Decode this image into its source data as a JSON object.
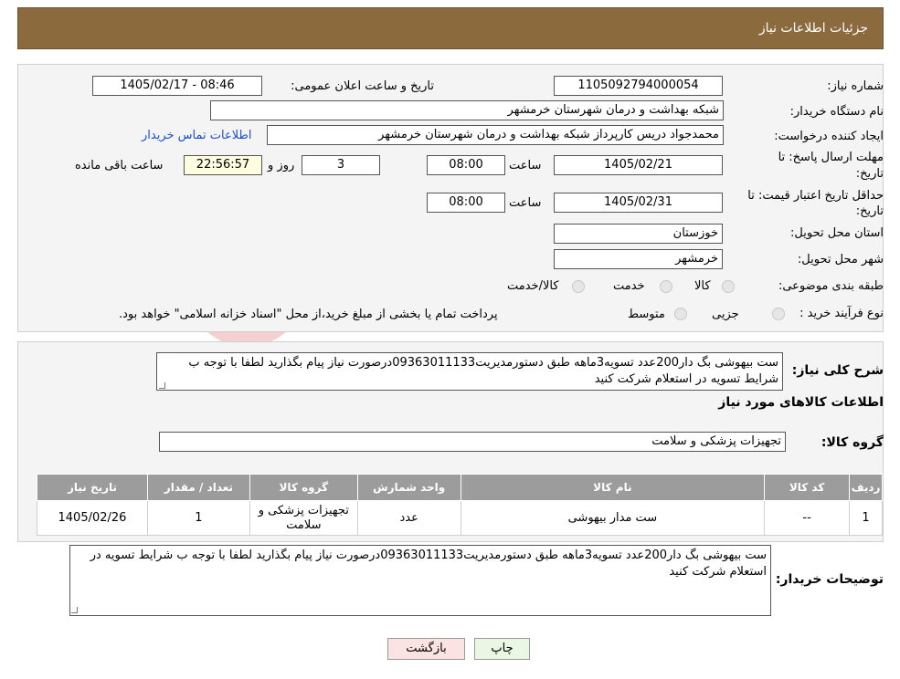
{
  "header": {
    "title": "جزئیات اطلاعات نیاز"
  },
  "fields": {
    "need_number_label": "شماره نیاز:",
    "need_number": "1105092794000054",
    "announce_label": "تاریخ و ساعت اعلان عمومی:",
    "announce_value": "1405/02/17 - 08:46",
    "buyer_org_label": "نام دستگاه خریدار:",
    "buyer_org": "شبکه بهداشت و درمان شهرستان خرمشهر",
    "creator_label": "ایجاد کننده درخواست:",
    "creator": "محمدجواد دریس کارپرداز شبکه بهداشت و درمان شهرستان خرمشهر",
    "contact_link": "اطلاعات تماس خریدار",
    "deadline_label_1": "مهلت ارسال پاسخ: تا",
    "deadline_label_2": "تاریخ:",
    "deadline_date": "1405/02/21",
    "time_label": "ساعت",
    "deadline_time": "08:00",
    "days_value": "3",
    "days_label": "روز و",
    "remaining_time": "22:56:57",
    "remaining_label": "ساعت باقی مانده",
    "validity_label_1": "حداقل تاریخ اعتبار قیمت: تا",
    "validity_label_2": "تاریخ:",
    "validity_date": "1405/02/31",
    "validity_time": "08:00",
    "province_label": "استان محل تحویل:",
    "province": "خوزستان",
    "city_label": "شهر محل تحویل:",
    "city": "خرمشهر",
    "category_label": "طبقه بندی موضوعی:",
    "category_options": [
      "کالا",
      "خدمت",
      "کالا/خدمت"
    ],
    "process_label": "نوع فرآیند خرید :",
    "process_options": [
      "جزیی",
      "متوسط"
    ],
    "process_note": "پرداخت تمام یا بخشی از مبلغ خرید،از محل \"اسناد خزانه اسلامی\" خواهد بود."
  },
  "description": {
    "label": "شرح کلی نیاز:",
    "text": "ست بیهوشی بگ دار200عدد تسویه3ماهه طبق دستورمدیریت09363011133درصورت نیاز پیام بگذارید لطفا با توجه ب شرایط تسویه در استعلام شرکت کنید"
  },
  "goods": {
    "section_title": "اطلاعات کالاهای مورد نیاز",
    "group_label": "گروه کالا:",
    "group_value": "تجهیزات پزشکی و سلامت",
    "columns": [
      "ردیف",
      "کد کالا",
      "نام کالا",
      "واحد شمارش",
      "گروه کالا",
      "تعداد / مقدار",
      "تاریخ نیاز"
    ],
    "rows": [
      [
        "1",
        "--",
        "ست مدار بیهوشی",
        "عدد",
        "تجهیزات پزشکی و سلامت",
        "1",
        "1405/02/26"
      ]
    ]
  },
  "buyer_notes": {
    "label": "توضیحات خریدار:",
    "text": "ست بیهوشی بگ دار200عدد تسویه3ماهه طبق دستورمدیریت09363011133درصورت نیاز پیام بگذارید لطفا با توجه ب شرایط تسویه در استعلام شرکت کنید"
  },
  "buttons": {
    "print": "چاپ",
    "back": "بازگشت"
  },
  "colors": {
    "header_bg": "#8b6a3e",
    "table_header_bg": "#9c9c9c",
    "print_btn": "#eaf7e2",
    "back_btn": "#fbe3e3"
  }
}
